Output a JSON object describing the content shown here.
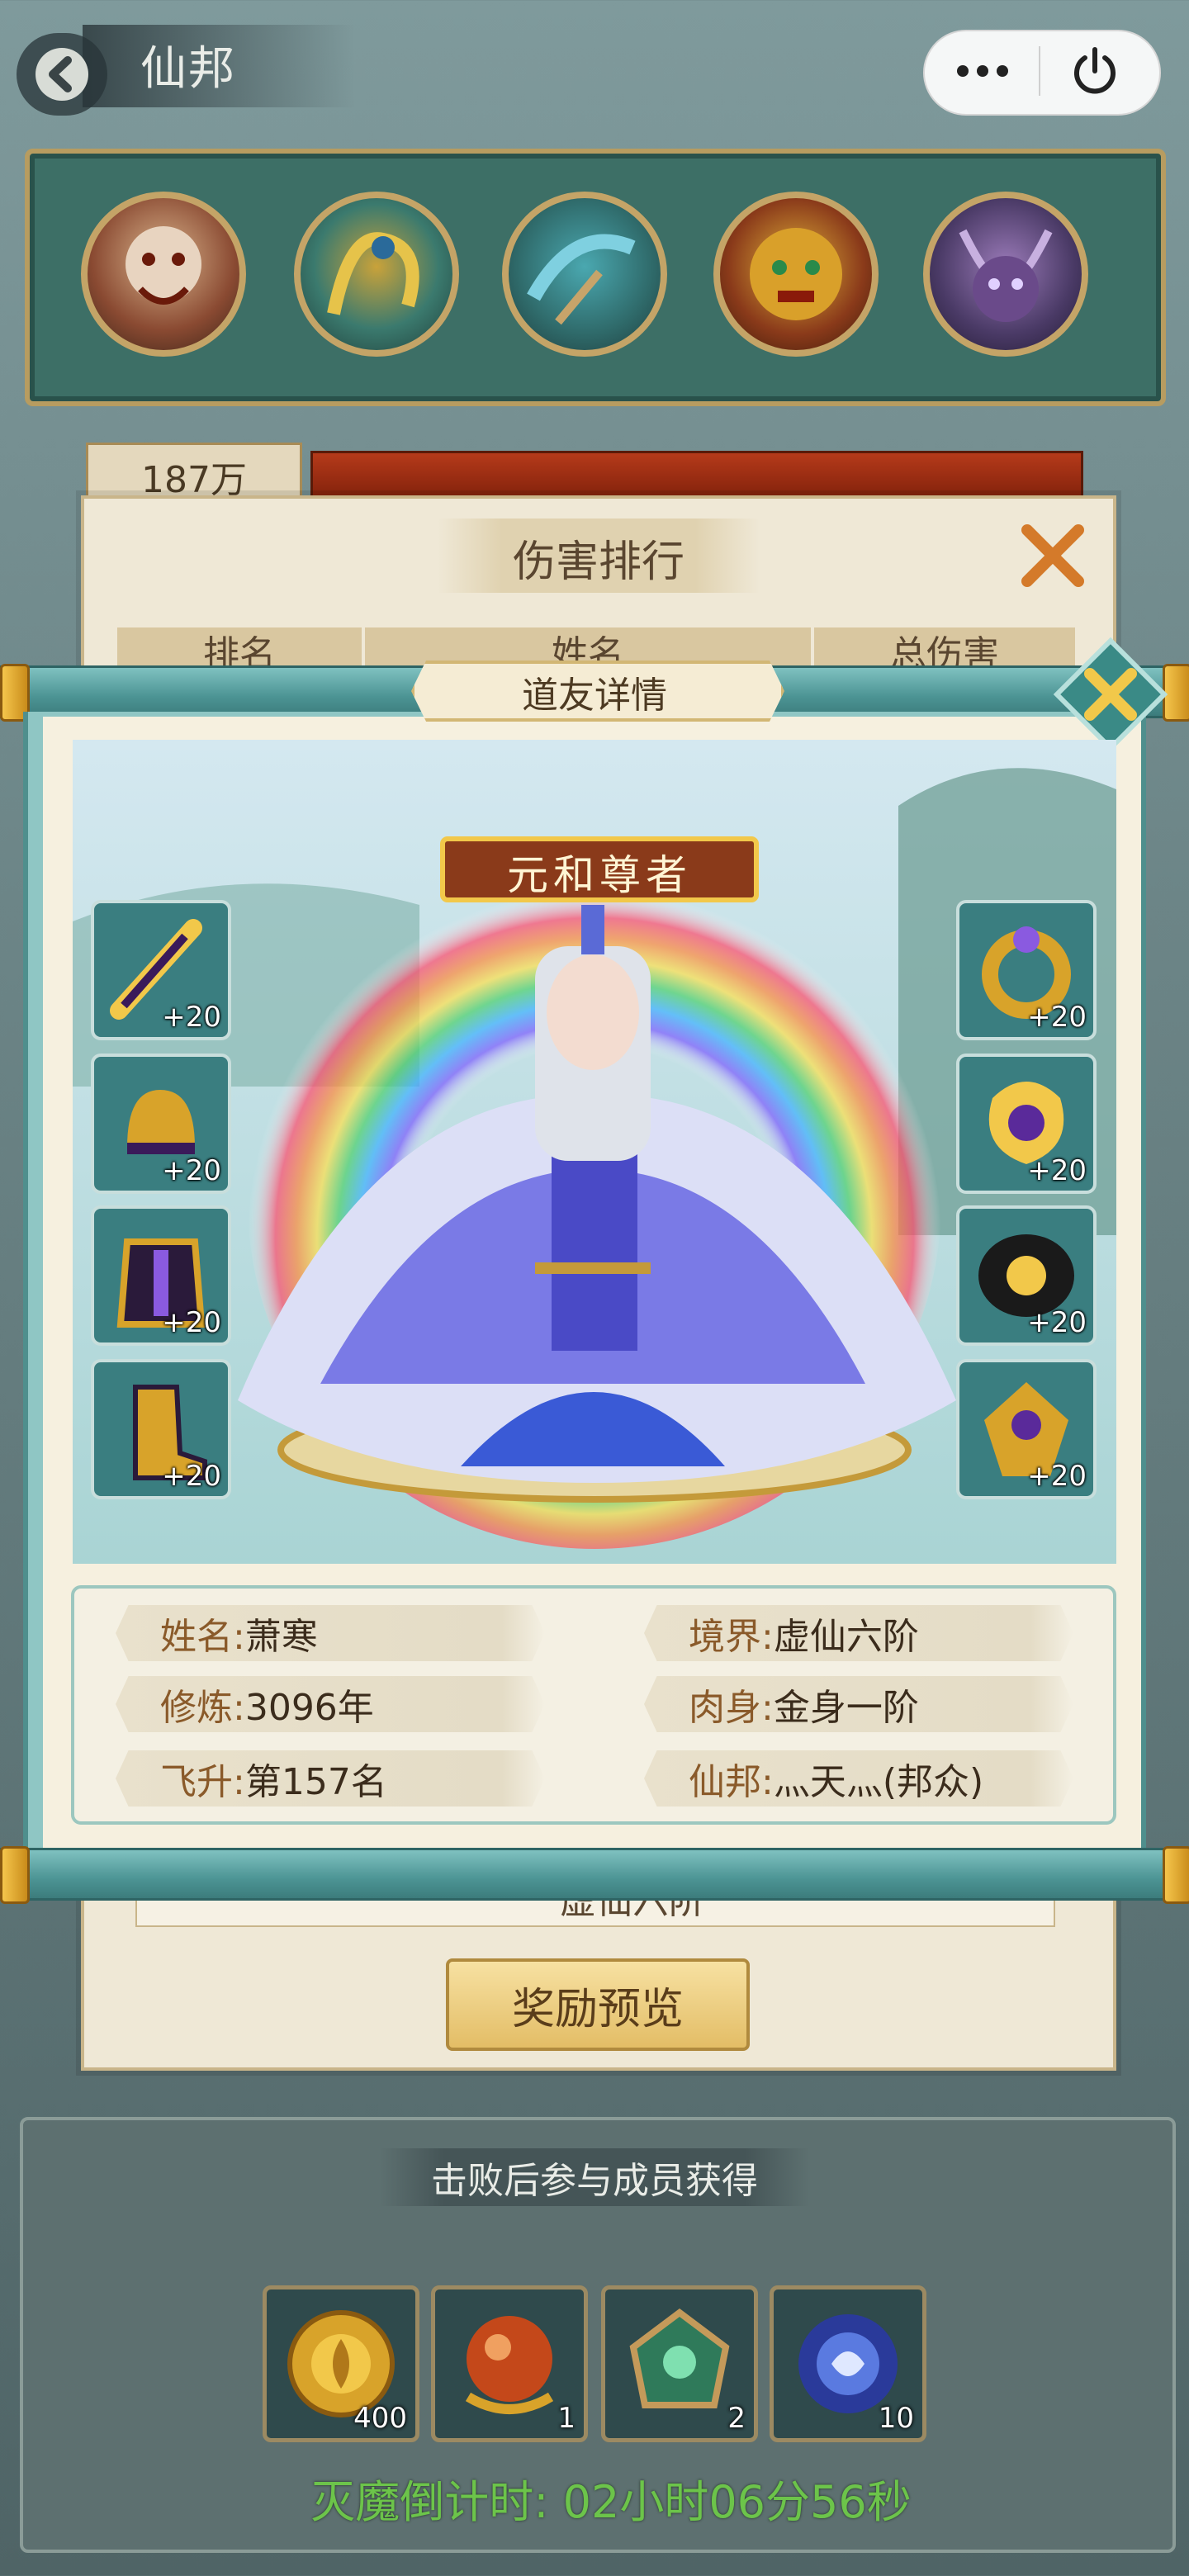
{
  "header": {
    "title": "仙邦"
  },
  "boss_hp": {
    "label": "187万",
    "fill_fraction": 1.0
  },
  "ranking_panel": {
    "title": "伤害排行",
    "columns": [
      "排名",
      "姓名",
      "总伤害"
    ],
    "partial_row_text": "虚仙六阶",
    "reward_button": "奖励预览"
  },
  "modal": {
    "title": "道友详情",
    "hero_title": "元和尊者",
    "left_equipment": [
      {
        "name": "sword-icon",
        "level": "+20"
      },
      {
        "name": "helmet-icon",
        "level": "+20"
      },
      {
        "name": "armor-icon",
        "level": "+20"
      },
      {
        "name": "boots-icon",
        "level": "+20"
      }
    ],
    "right_equipment": [
      {
        "name": "ring-icon",
        "level": "+20"
      },
      {
        "name": "amulet-icon",
        "level": "+20"
      },
      {
        "name": "bracer-icon",
        "level": "+20"
      },
      {
        "name": "pendant-icon",
        "level": "+20"
      }
    ],
    "info": {
      "name_label": "姓名:",
      "name_value": "萧寒",
      "realm_label": "境界:",
      "realm_value": "虚仙六阶",
      "cultivation_label": "修炼:",
      "cultivation_value": "3096年",
      "body_label": "肉身:",
      "body_value": "金身一阶",
      "ascend_label": "飞升:",
      "ascend_value": "第157名",
      "sect_label": "仙邦:",
      "sect_value": "灬天灬(邦众)"
    }
  },
  "rewards": {
    "label": "击败后参与成员获得",
    "items": [
      {
        "icon": "gold-coin-icon",
        "count": "400"
      },
      {
        "icon": "dragon-orb-icon",
        "count": "1"
      },
      {
        "icon": "jade-token-icon",
        "count": "2"
      },
      {
        "icon": "blue-spirit-icon",
        "count": "10"
      }
    ]
  },
  "countdown": "灭魔倒计时: 02小时06分56秒",
  "colors": {
    "accent_gold": "#c4a467",
    "teal_frame": "#3d6f66",
    "countdown_green": "#6cc44a"
  }
}
